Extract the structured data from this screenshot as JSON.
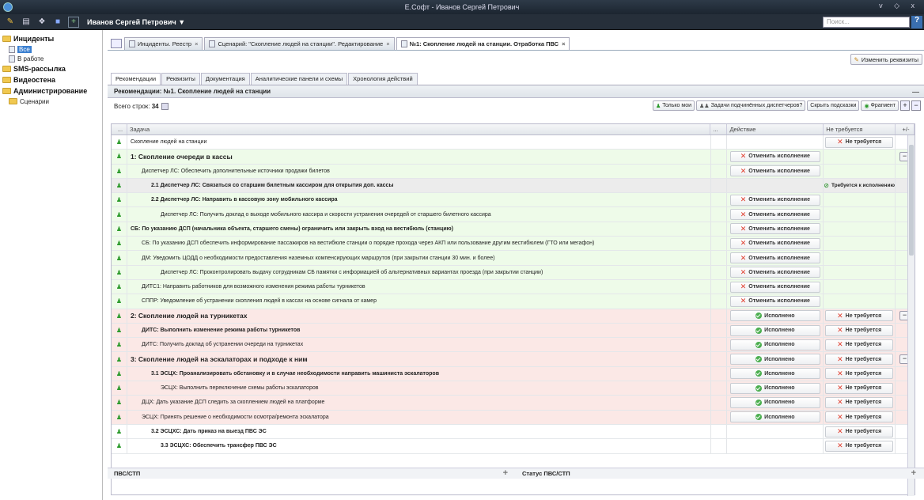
{
  "window": {
    "title": "Е.Софт - Иванов Сергей Петрович",
    "controls": "v ◇ x"
  },
  "topbar": {
    "user": "Иванов Сергей Петрович ▼",
    "search_placeholder": "Поиск...",
    "help": "?"
  },
  "sidebar": {
    "incidents": "Инциденты",
    "all": "Все",
    "in_work": "В работе",
    "sms": "SMS-рассылка",
    "video": "Видеостена",
    "admin": "Администрирование",
    "scenarios": "Сценарии"
  },
  "tabs": [
    {
      "label": "Инциденты. Реестр"
    },
    {
      "label": "Сценарий: \"Скопление людей на станции\". Редактирование"
    },
    {
      "label": "№1: Скопление людей на станции. Отработка ПВС"
    }
  ],
  "edit_req": "Изменить реквизиты",
  "subtabs": [
    "Рекомендации",
    "Реквизиты",
    "Документация",
    "Аналитические панели и схемы",
    "Хронология действий"
  ],
  "panel_title": "Рекомендации: №1. Скопление людей на станции",
  "toolbar": {
    "total_label": "Всего строк:",
    "total_value": "34",
    "btn_mine": "Только мои",
    "btn_sub": "Задачи подчинённых диспетчеров?",
    "btn_hints": "Скрыть подсказки",
    "btn_fragment": "Фрагмент"
  },
  "columns": {
    "dots": "...",
    "task": "Задача",
    "dots2": "...",
    "action": "Действие",
    "notreq": "Не требуется",
    "pm": "+/-"
  },
  "labels": {
    "cancel": "Отменить исполнение",
    "done": "Исполнено",
    "notreq": "Не требуется",
    "required": "Требуется к исполнению"
  },
  "rows": [
    {
      "text": "Скопление людей на станции"
    },
    {
      "text": "1: Скопление очереди в кассы"
    },
    {
      "text": "Диспетчер ЛС: Обеспечить дополнительные источники продажи билетов"
    },
    {
      "text": "2.1 Диспетчер ЛС: Связаться со старшим билетным кассиром для открытия доп. кассы"
    },
    {
      "text": "2.2 Диспетчер ЛС: Направить в кассовую зону мобильного кассира"
    },
    {
      "text": "Диспетчер ЛС: Получить доклад о выходе мобильного кассира и скорости устранения очередей от старшего билетного кассира"
    },
    {
      "text": "СБ: По указанию ДСП (начальника объекта, старшего смены) ограничить или закрыть вход на вестибюль (станцию)"
    },
    {
      "text": "СБ: По указанию ДСП обеспечить информирование пассажиров на вестибюле станции о порядке прохода через АКП или пользование другим вестибюлем (ГТО или мегафон)"
    },
    {
      "text": "ДМ: Уведомить ЦОДД о необходимости предоставления наземных компенсирующих маршрутов (при закрытии станции 30 мин. и более)"
    },
    {
      "text": "Диспетчер ЛС: Проконтролировать выдачу сотрудникам СБ памятки с информацией об альтернативных вариантах проезда (при закрытии станции)"
    },
    {
      "text": "ДИТС1: Направить работников для возможного изменения режима работы турникетов"
    },
    {
      "text": "СППР: Уведомление об устранении скопления людей в кассах на основе сигнала от камер"
    },
    {
      "text": "2: Скопление людей на турникетах"
    },
    {
      "text": "ДИТС: Выполнить изменение режима работы турникетов"
    },
    {
      "text": "ДИТС: Получить доклад об устранении очереди на турникетах"
    },
    {
      "text": "3: Скопление людей на эскалаторах и подходе к ним"
    },
    {
      "text": "3.1 ЭСЦХ: Проанализировать обстановку и в случае необходимости направить машиниста эскалаторов"
    },
    {
      "text": "ЭСЦХ: Выполнить переключение схемы работы эскалаторов"
    },
    {
      "text": "ДЦХ: Дать указание ДСП следить за скоплением людей на платформе"
    },
    {
      "text": "ЭСЦХ: Принять решение о необходимости осмотра/ремонта эскалатора"
    },
    {
      "text": "3.2 ЭСЦХС: Дать приказ на выезд ПВС ЭС"
    },
    {
      "text": "3.3 ЭСЦХС: Обеспечить трансфер ПВС ЭС"
    }
  ],
  "bottom": {
    "left": "ПВС/СТП",
    "right": "Статус ПВС/СТП"
  }
}
